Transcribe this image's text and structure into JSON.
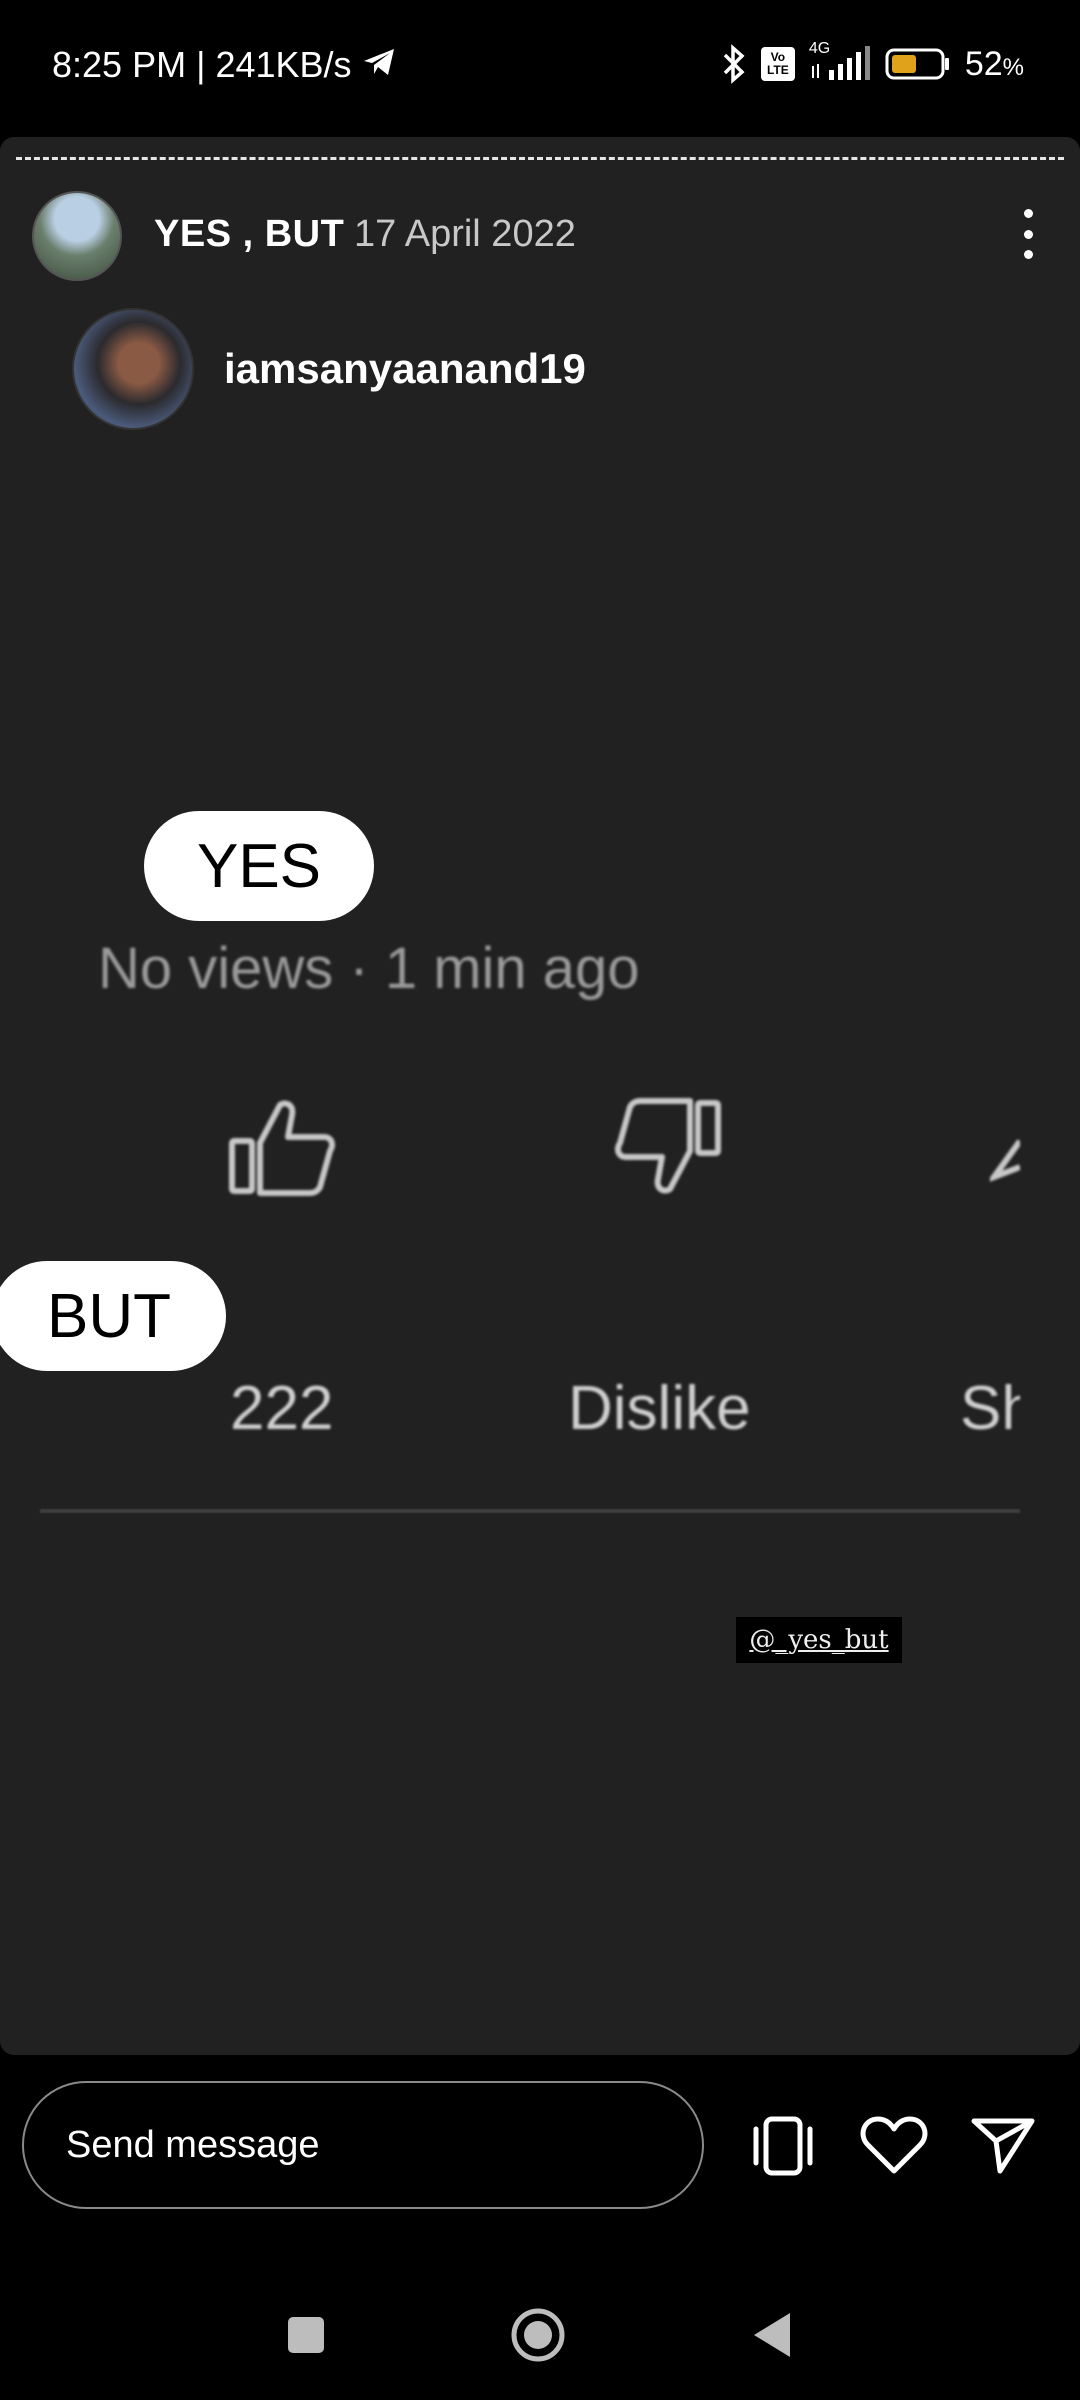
{
  "status_bar": {
    "time": "8:25 PM",
    "separator": "|",
    "speed": "241KB/s",
    "network": "4G",
    "volte": "Vo LTE",
    "battery": "52",
    "battery_unit": "%",
    "battery_level": 0.52,
    "icons": [
      "telegram-icon",
      "bluetooth-icon",
      "volte-icon",
      "signal-icon",
      "battery-icon"
    ]
  },
  "story": {
    "account_name": "YES , BUT",
    "date": "17 April 2022",
    "mention": "iamsanyaanand19",
    "yes_label": "YES",
    "but_label": "BUT",
    "video_meta": "No views · 1 min ago",
    "like_count": "222",
    "dislike_label": "Dislike",
    "share_label": "Sh",
    "watermark": "@_yes_but"
  },
  "reply_bar": {
    "placeholder": "Send message"
  },
  "colors": {
    "background": "#000000",
    "story_bg": "#212121",
    "battery_fill": "#e0a21a"
  }
}
